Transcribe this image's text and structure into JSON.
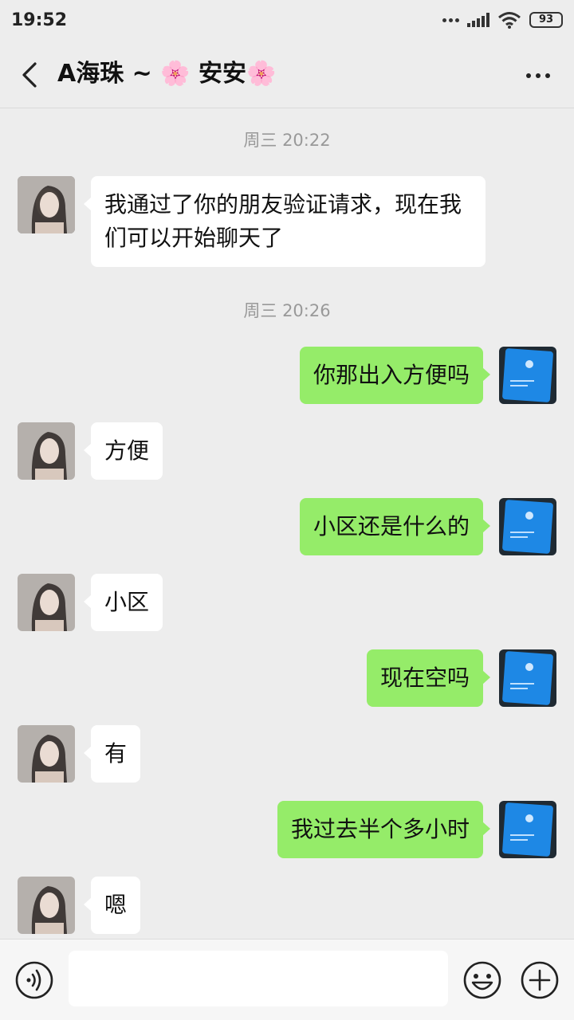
{
  "status_bar": {
    "time": "19:52",
    "battery": "93"
  },
  "header": {
    "title": "A海珠 ~ 🌸 安安🌸"
  },
  "messages": [
    {
      "type": "time",
      "text": "周三 20:22"
    },
    {
      "type": "in",
      "text": "我通过了你的朋友验证请求，现在我们可以开始聊天了"
    },
    {
      "type": "time",
      "text": "周三 20:26"
    },
    {
      "type": "out",
      "text": "你那出入方便吗"
    },
    {
      "type": "in",
      "text": "方便"
    },
    {
      "type": "out",
      "text": "小区还是什么的"
    },
    {
      "type": "in",
      "text": "小区"
    },
    {
      "type": "out",
      "text": "现在空吗"
    },
    {
      "type": "in",
      "text": "有"
    },
    {
      "type": "out",
      "text": "我过去半个多小时"
    },
    {
      "type": "in",
      "text": "嗯"
    }
  ],
  "input": {
    "placeholder": ""
  },
  "colors": {
    "outgoing_bubble": "#95ec69",
    "incoming_bubble": "#ffffff",
    "background": "#ededed"
  }
}
